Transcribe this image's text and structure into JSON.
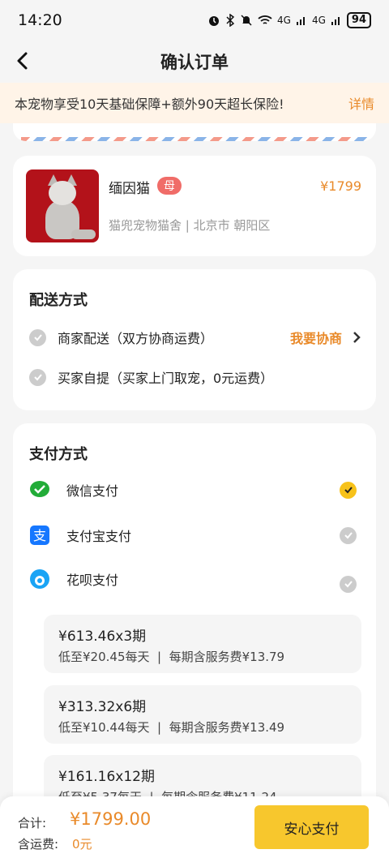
{
  "status_bar": {
    "time": "14:20",
    "network": "4G",
    "network2": "4G",
    "battery": "94"
  },
  "nav": {
    "title": "确认订单"
  },
  "notice": {
    "text": "本宠物享受10天基础保障+额外90天超长保险!",
    "link": "详情"
  },
  "product": {
    "name": "缅因猫",
    "gender_tag": "母",
    "price": "¥1799",
    "shop": "猫兜宠物猫舍 | 北京市 朝阳区"
  },
  "delivery": {
    "title": "配送方式",
    "options": [
      {
        "label": "商家配送（双方协商运费）",
        "link": "我要协商"
      },
      {
        "label": "买家自提（买家上门取宠，0元运费）"
      }
    ]
  },
  "payment": {
    "title": "支付方式",
    "methods": [
      {
        "label": "微信支付",
        "icon": "wechat-pay-icon",
        "selected": true
      },
      {
        "label": "支付宝支付",
        "icon": "alipay-icon",
        "selected": false
      },
      {
        "label": "花呗支付",
        "icon": "huabei-icon",
        "selected": false
      }
    ],
    "plans": [
      {
        "amount": "¥613.46x3期",
        "detail": "低至¥20.45每天  |  每期含服务费¥13.79"
      },
      {
        "amount": "¥313.32x6期",
        "detail": "低至¥10.44每天  |  每期含服务费¥13.49"
      },
      {
        "amount": "¥161.16x12期",
        "detail": "低至¥5.37每天  |  每期含服务费¥11.24"
      }
    ]
  },
  "bottom_bar": {
    "total_label": "合计:",
    "total_value": "¥1799.00",
    "shipping_label": "含运费:",
    "shipping_value": "0元",
    "pay_button": "安心支付"
  },
  "colors": {
    "accent_orange": "#e98a2a",
    "accent_yellow": "#f7c21a",
    "tag_red": "#f06c68"
  }
}
